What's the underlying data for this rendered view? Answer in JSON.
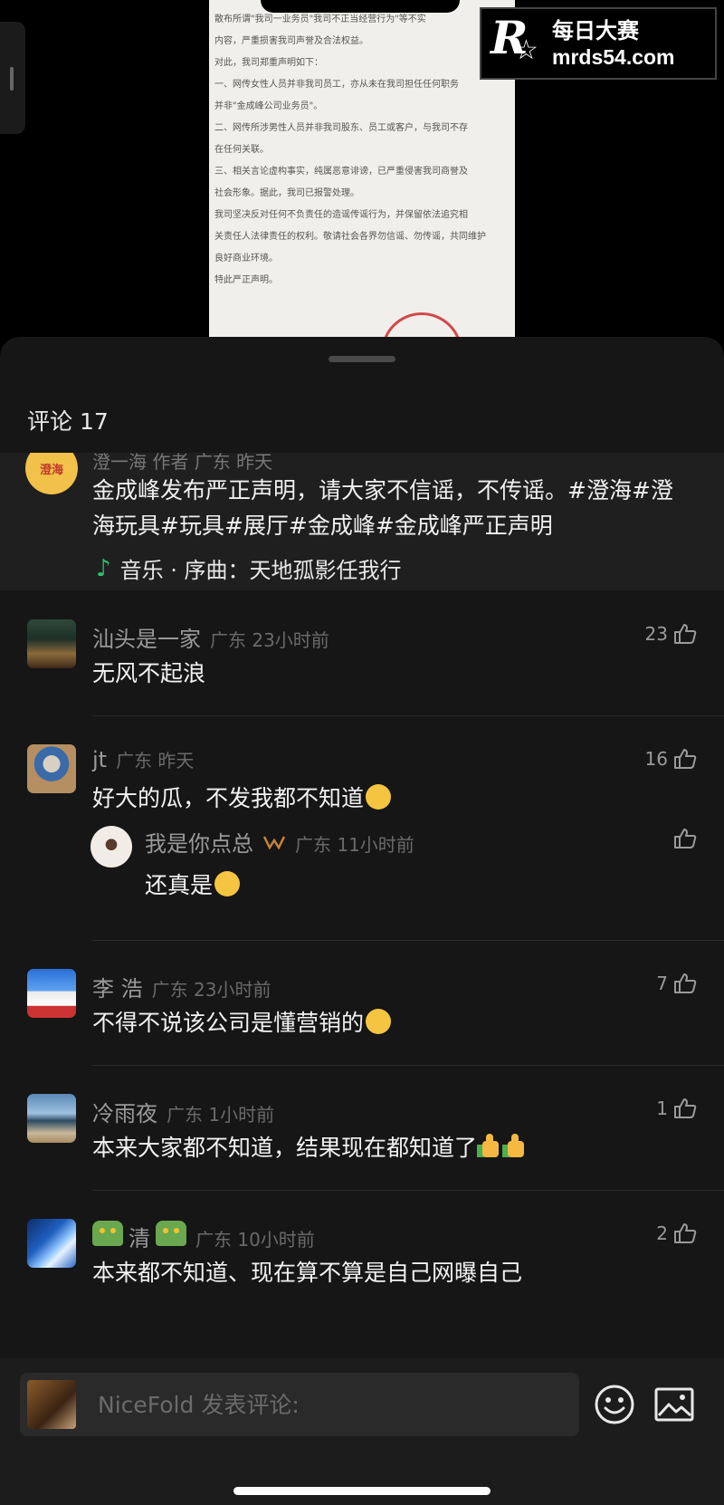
{
  "watermark": {
    "line1": "每日大赛",
    "line2": "mrds54.com",
    "logo_text": "R"
  },
  "document": {
    "lines": [
      "散布所谓\"我司一业务员\"我司不正当经营行为\"等不实",
      "内容，严重损害我司声誉及合法权益。",
      "对此，我司郑重声明如下：",
      "一、网传女性人员并非我司员工，亦从未在我司担任任何职务",
      "并非\"金成峰公司业务员\"。",
      "二、网传所涉男性人员并非我司股东、员工或客户，与我司不存",
      "在任何关联。",
      "三、相关言论虚构事实，纯属恶意诽谤，已严重侵害我司商誉及",
      "社会形象。据此，我司已报警处理。",
      "我司坚决反对任何不负责任的造谣传谣行为，并保留依法追究相",
      "关责任人法律责任的权利。敬请社会各界勿信谣、勿传谣，共同维护",
      "良好商业环境。",
      "特此严正声明。"
    ]
  },
  "sheet": {
    "title": "评论 17"
  },
  "author_post": {
    "avatar_text": "澄海",
    "meta": "澄一海 作者 广东 昨天",
    "body": "金成峰发布严正声明，请大家不信谣，不传谣。#澄海#澄海玩具#玩具#展厅#金成峰#金成峰严正声明",
    "music": "音乐 · 序曲：天地孤影任我行"
  },
  "comments": [
    {
      "name": "汕头是一家",
      "location": "广东 23小时前",
      "text": "无风不起浪",
      "likes": "23"
    },
    {
      "name": "jt",
      "location": "广东 昨天",
      "text": "好大的瓜，不发我都不知道",
      "likes": "16",
      "reply": {
        "name": "我是你点总",
        "location": "广东 11小时前",
        "text": "还真是"
      }
    },
    {
      "name": "李 浩",
      "location": "广东 23小时前",
      "text": "不得不说该公司是懂营销的",
      "likes": "7"
    },
    {
      "name": "冷雨夜",
      "location": "广东 1小时前",
      "text": "本来大家都不知道，结果现在都知道了",
      "likes": "1"
    },
    {
      "name": "清",
      "location": "广东 10小时前",
      "text": "本来都不知道、现在算不算是自己网曝自己",
      "likes": "2"
    }
  ],
  "input": {
    "placeholder": "NiceFold 发表评论:"
  },
  "icons": {
    "like": "thumbs-up-icon",
    "emoji": "smiley-icon",
    "image": "image-icon",
    "music": "music-note-icon"
  }
}
